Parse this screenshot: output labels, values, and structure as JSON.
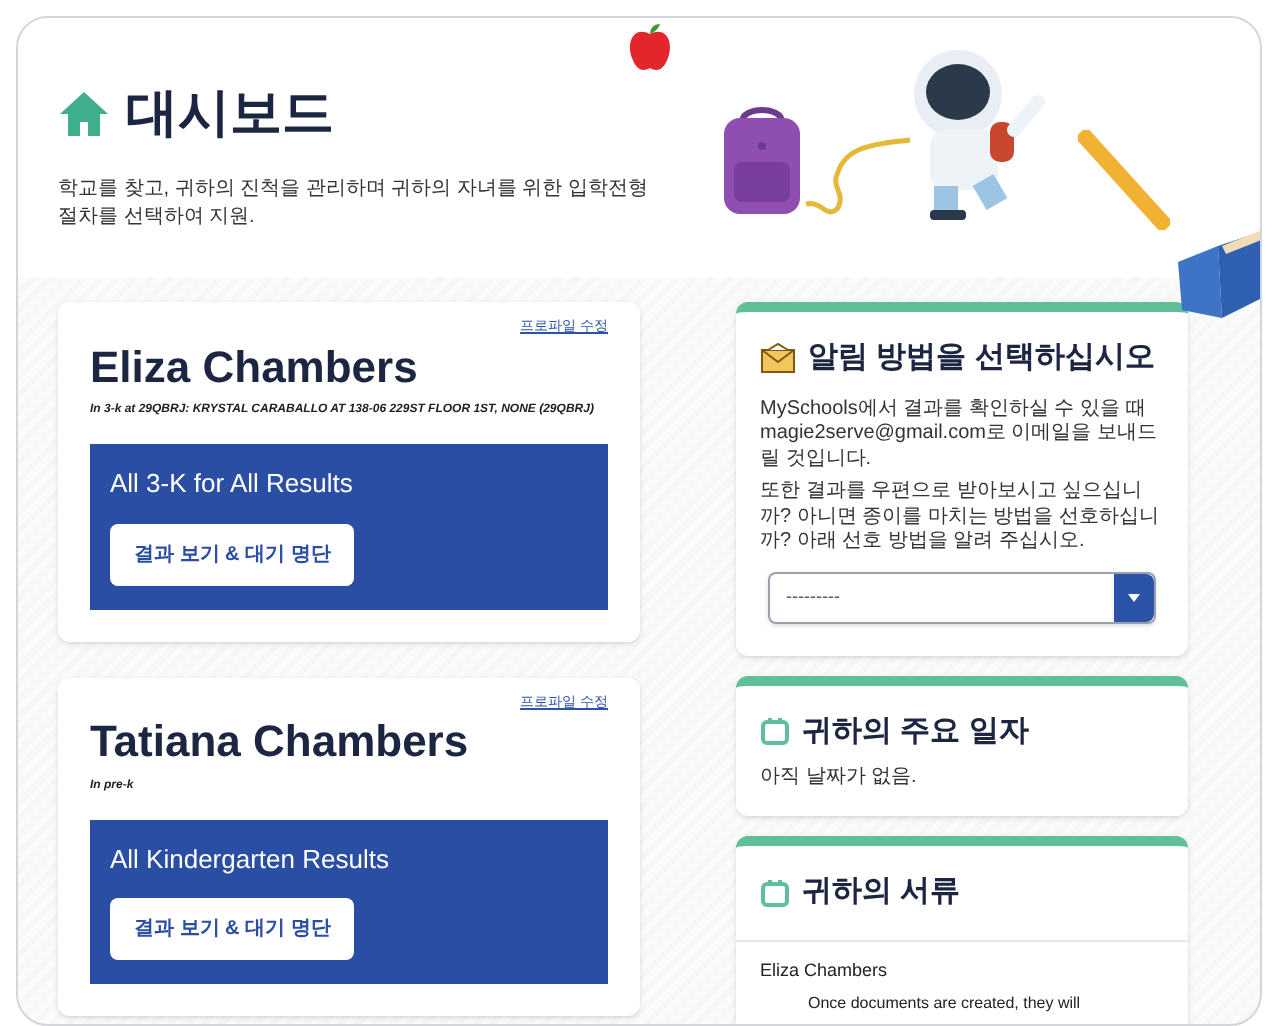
{
  "header": {
    "title": "대시보드",
    "subtitle": "학교를 찾고, 귀하의 진척을 관리하며 귀하의 자녀를 위한 입학전형 절차를 선택하여 지원."
  },
  "students": [
    {
      "name": "Eliza Chambers",
      "edit_link": "프로파일 수정",
      "enrollment": "In 3-k at 29QBRJ: KRYSTAL CARABALLO AT 138-06 229ST FLOOR 1ST, NONE (29QBRJ)",
      "results_title": "All 3-K for All Results",
      "button": "결과 보기 & 대기 명단"
    },
    {
      "name": "Tatiana Chambers",
      "edit_link": "프로파일 수정",
      "enrollment": "In pre-k",
      "results_title": "All Kindergarten Results",
      "button": "결과 보기 & 대기 명단"
    }
  ],
  "notifications": {
    "title": "알림 방법을 선택하십시오",
    "paragraphs": [
      "MySchools에서 결과를 확인하실 수 있을 때 magie2serve@gmail.com로 이메일을 보내드릴 것입니다.",
      "또한 결과를 우편으로 받아보시고 싶으십니까? 아니면 종이를 마치는 방법을 선호하십니까? 아래 선호 방법을 알려 주십시오."
    ],
    "select": {
      "value": "---------"
    }
  },
  "key_dates": {
    "title": "귀하의 주요 일자",
    "message": "아직 날짜가 없음."
  },
  "documents": {
    "title": "귀하의 서류",
    "student": "Eliza Chambers",
    "message": "Once documents are created, they will"
  }
}
